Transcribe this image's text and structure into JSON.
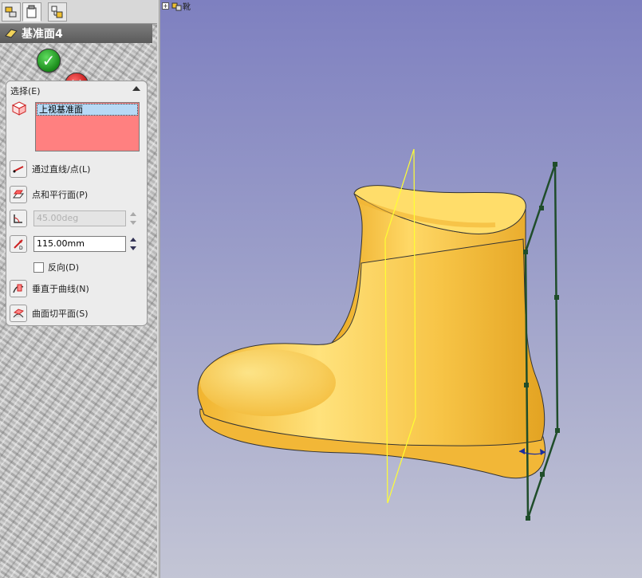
{
  "tabs": [
    {
      "name": "featuremanager-tab"
    },
    {
      "name": "propertymanager-tab"
    },
    {
      "name": "configurationmanager-tab"
    }
  ],
  "property_manager": {
    "title": "基准面4",
    "ok_label": "✓",
    "cancel_label": "✕",
    "help_label": "?",
    "selection_group": {
      "title": "选择(E)",
      "selected_item": "上视基准面"
    },
    "options": {
      "through_lines_points": "通过直线/点(L)",
      "parallel_plane_at_point": "点和平行面(P)",
      "angle_value": "45.00deg",
      "offset_value": "115.00mm",
      "reverse_label": "反向(D)",
      "normal_to_curve": "垂直于曲线(N)",
      "on_surface": "曲面切平面(S)"
    }
  },
  "viewport": {
    "tree_tag": "靴"
  },
  "colors": {
    "boot": "#f6c242",
    "plane_yellow": "#ffff33",
    "plane_green": "#1f4d2a",
    "selection_list": "#ff8080"
  }
}
